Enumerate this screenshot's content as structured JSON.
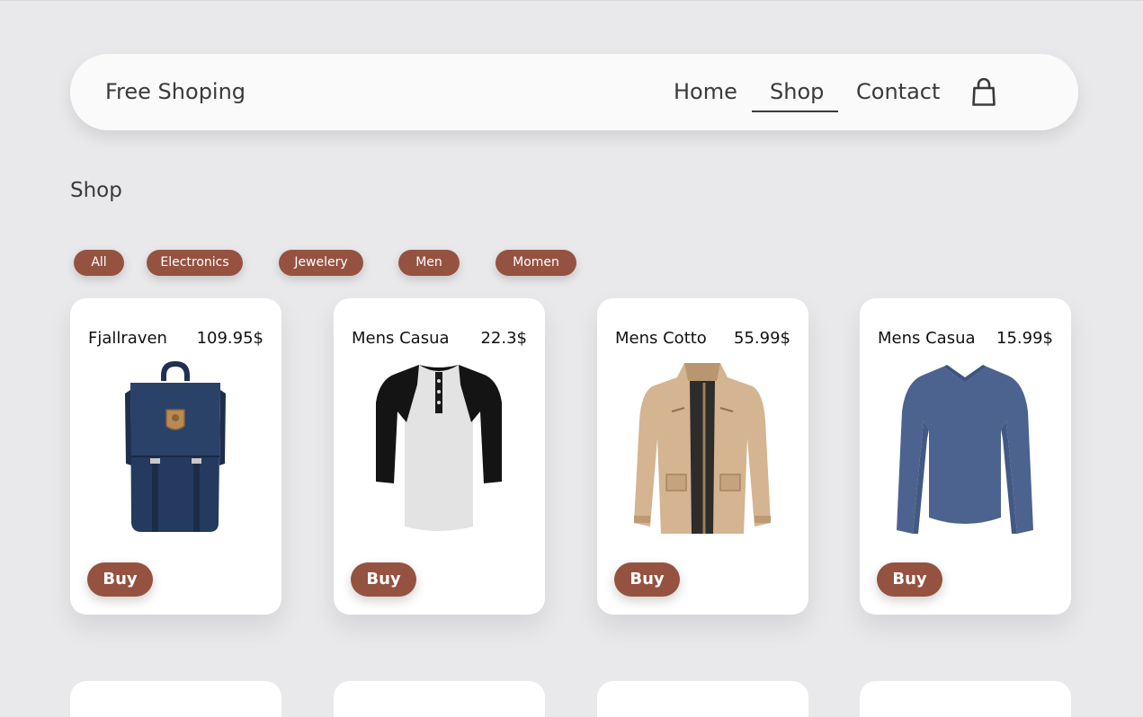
{
  "nav": {
    "brand": "Free Shoping",
    "links": [
      {
        "label": "Home",
        "active": false
      },
      {
        "label": "Shop",
        "active": true
      },
      {
        "label": "Contact",
        "active": false
      }
    ],
    "cart_icon": "shopping-bag-icon"
  },
  "page": {
    "title": "Shop"
  },
  "filters": [
    {
      "label": "All"
    },
    {
      "label": "Electronics"
    },
    {
      "label": "Jewelery"
    },
    {
      "label": "Men"
    },
    {
      "label": "Momen"
    }
  ],
  "products": [
    {
      "name": "Fjallraven",
      "price": "109.95$",
      "buy_label": "Buy",
      "image": "navy-backpack"
    },
    {
      "name": "Mens Casua",
      "price": "22.3$",
      "buy_label": "Buy",
      "image": "raglan-henley-tshirt"
    },
    {
      "name": "Mens Cotto",
      "price": "55.99$",
      "buy_label": "Buy",
      "image": "khaki-cotton-jacket"
    },
    {
      "name": "Mens Casua",
      "price": "15.99$",
      "buy_label": "Buy",
      "image": "blue-long-sleeve-shirt"
    }
  ],
  "colors": {
    "accent": "#955240",
    "background": "#e9e9eb",
    "navbar": "#fafafa",
    "card": "#ffffff"
  }
}
